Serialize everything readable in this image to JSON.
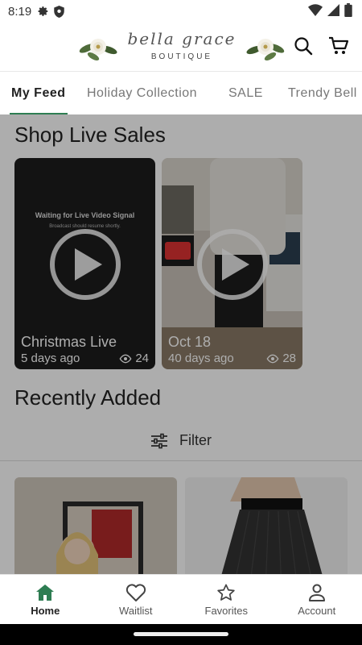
{
  "status_bar": {
    "time": "8:19"
  },
  "header": {
    "logo_script": "bella grace",
    "logo_sub": "BOUTIQUE"
  },
  "tabs": [
    {
      "label": "My Feed",
      "active": true
    },
    {
      "label": "Holiday Collection",
      "active": false
    },
    {
      "label": "SALE",
      "active": false
    },
    {
      "label": "Trendy Bell",
      "active": false
    }
  ],
  "live_sales": {
    "title": "Shop Live Sales",
    "items": [
      {
        "title": "Christmas Live",
        "when": "5 days ago",
        "views": "24",
        "overlay": "Waiting for Live Video Signal",
        "overlay_sub": "Broadcast should resume shortly."
      },
      {
        "title": "Oct 18",
        "when": "40 days ago",
        "views": "28"
      }
    ]
  },
  "recently_added": {
    "title": "Recently Added",
    "filter_label": "Filter"
  },
  "bottom_nav": [
    {
      "label": "Home",
      "icon": "home-icon",
      "active": true
    },
    {
      "label": "Waitlist",
      "icon": "heart-icon",
      "active": false
    },
    {
      "label": "Favorites",
      "icon": "star-icon",
      "active": false
    },
    {
      "label": "Account",
      "icon": "person-icon",
      "active": false
    }
  ],
  "colors": {
    "accent": "#2e7d52",
    "scrim": "rgba(0,0,0,0.32)"
  }
}
